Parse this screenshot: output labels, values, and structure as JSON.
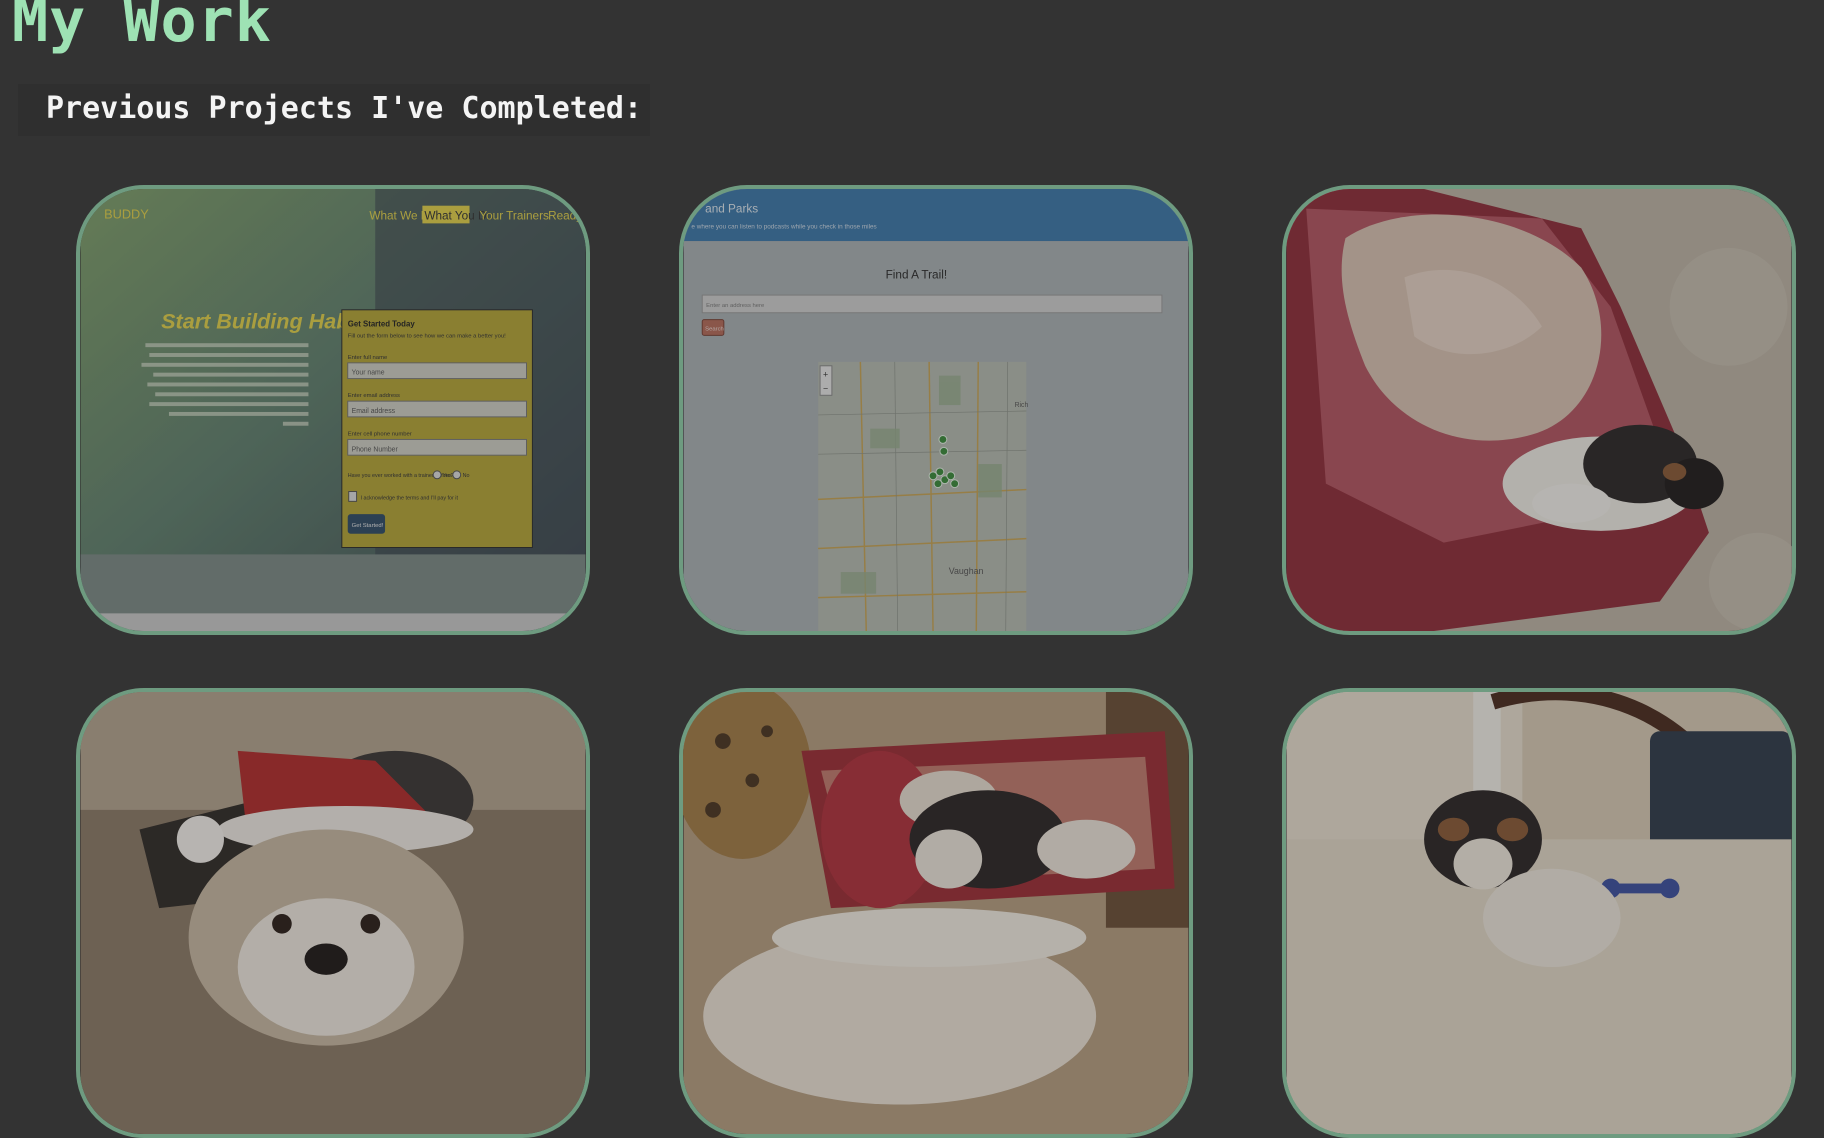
{
  "header": {
    "title": "My Work"
  },
  "section": {
    "title": "Previous Projects I've Completed:"
  },
  "projects": [
    {
      "brand": "BUDDY",
      "nav": [
        "What We Do",
        "What You Do",
        "Your Trainers",
        "Ready"
      ],
      "hero_title": "Start Building Habits",
      "form": {
        "heading": "Get Started Today",
        "subheading": "Fill out the form below to see how we can make a better you!",
        "name_label": "Enter full name",
        "name_placeholder": "Your name",
        "email_label": "Enter email address",
        "email_placeholder": "Email address",
        "phone_label": "Enter cell phone number",
        "phone_placeholder": "Phone Number",
        "question": "Have you ever worked with a trainer before?",
        "yes": "Yes",
        "no": "No",
        "consent": "I acknowledge the terms and I'll pay for it",
        "button": "Get Started!"
      }
    },
    {
      "brand": "and Parks",
      "tagline": "e where you can listen to podcasts while you check in those miles",
      "heading": "Find A Trail!",
      "input_placeholder": "Enter an address here",
      "button": "Search",
      "map": {
        "zoom_in": "+",
        "zoom_out": "−",
        "city": "Vaughan",
        "edge_label": "Rich"
      }
    },
    {
      "subject": "puppy-in-bed-photo"
    },
    {
      "subject": "puppy-santa-hat-photo"
    },
    {
      "subject": "puppy-with-toys-photo"
    },
    {
      "subject": "puppy-on-rug-photo"
    }
  ]
}
